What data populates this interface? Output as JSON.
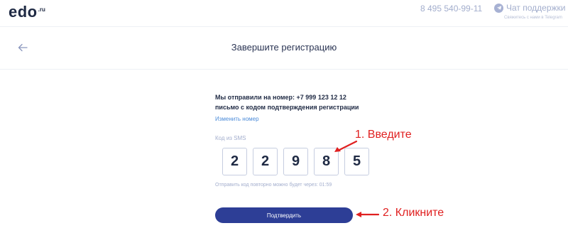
{
  "header": {
    "logo_main": "EDO",
    "logo_tld": ".ru",
    "phone": "8 495 540-99-11",
    "support_label": "Чат поддержки",
    "support_sub": "Свяжитесь с нами в Telegram"
  },
  "title_bar": {
    "title": "Завершите регистрацию"
  },
  "form": {
    "message_line1": "Мы отправили на номер: +7 999 123 12 12",
    "message_line2": "письмо с кодом подтверждения регистрации",
    "change_number": "Изменить номер",
    "code_label": "Код из SMS",
    "digits": [
      "2",
      "2",
      "9",
      "8",
      "5"
    ],
    "resend": "Отправить код повторно можно будет через: 01:59",
    "confirm_label": "Подтвердить"
  },
  "annotations": {
    "step1": "1. Введите",
    "step2": "2. Кликните"
  },
  "colors": {
    "primary": "#2d3e96",
    "link": "#4b8bd9",
    "muted": "#a3aecd",
    "annotation": "#e02020"
  }
}
